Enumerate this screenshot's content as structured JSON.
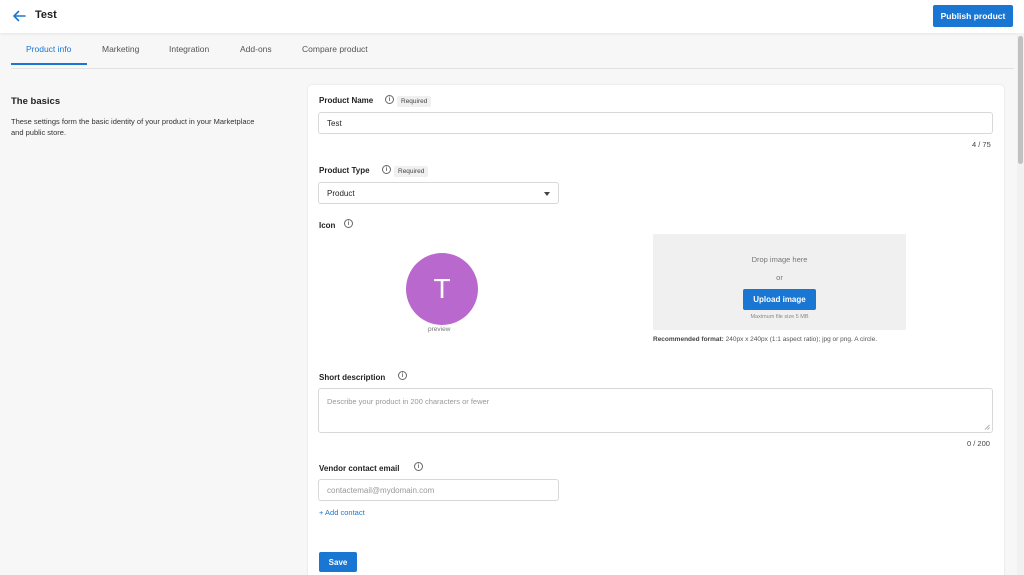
{
  "header": {
    "title": "Test",
    "publish_label": "Publish product"
  },
  "tabs": [
    {
      "label": "Product info",
      "active": true
    },
    {
      "label": "Marketing",
      "active": false
    },
    {
      "label": "Integration",
      "active": false
    },
    {
      "label": "Add-ons",
      "active": false
    },
    {
      "label": "Compare product",
      "active": false
    }
  ],
  "basics": {
    "title": "The basics",
    "description": "These settings form the basic identity of your product in your Marketplace and public store."
  },
  "form": {
    "product_name": {
      "label": "Product Name",
      "badge": "Required",
      "value": "Test",
      "counter": "4 / 75"
    },
    "product_type": {
      "label": "Product Type",
      "badge": "Required",
      "selected": "Product"
    },
    "icon": {
      "label": "Icon",
      "initial": "T",
      "preview_label": "preview",
      "drop_text": "Drop image here",
      "or_text": "or",
      "upload_label": "Upload image",
      "max_size": "Maximum file size 5 MB",
      "recommend_bold": "Recommended format:",
      "recommend_rest": " 240px x 240px (1:1 aspect ratio); jpg or png. A circle.",
      "avatar_color": "#b969cd"
    },
    "short_description": {
      "label": "Short description",
      "placeholder": "Describe your product in 200 characters or fewer",
      "counter": "0 / 200"
    },
    "vendor_email": {
      "label": "Vendor contact email",
      "placeholder": "contactemail@mydomain.com",
      "add_contact": "+ Add contact"
    },
    "save_label": "Save"
  },
  "colors": {
    "accent": "#1976d2"
  }
}
